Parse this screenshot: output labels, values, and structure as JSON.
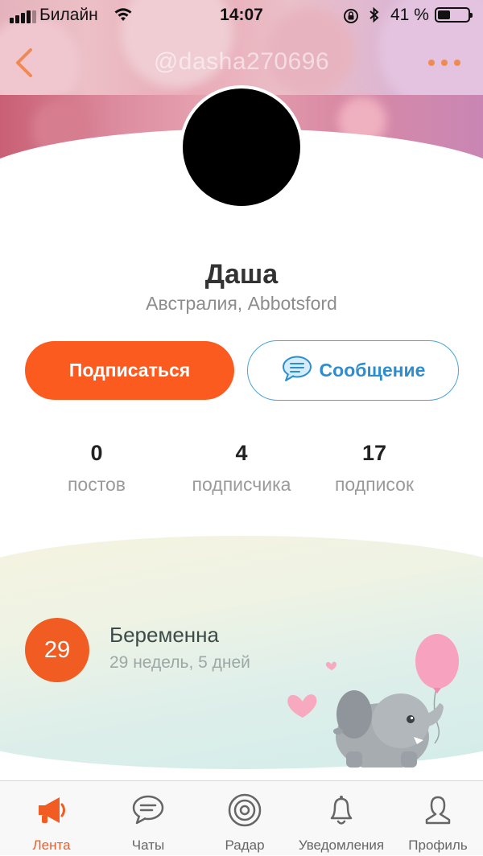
{
  "status_bar": {
    "carrier": "Билайн",
    "time": "14:07",
    "battery_text": "41 %",
    "battery_level": 0.41
  },
  "nav": {
    "title": "@dasha270696"
  },
  "profile": {
    "name": "Даша",
    "location": "Австралия, Abbotsford"
  },
  "actions": {
    "subscribe_label": "Подписаться",
    "message_label": "Сообщение"
  },
  "stats": [
    {
      "value": "0",
      "label": "постов"
    },
    {
      "value": "4",
      "label": "подписчика"
    },
    {
      "value": "17",
      "label": "подписок"
    }
  ],
  "pregnancy": {
    "week": "29",
    "title": "Беременна",
    "subtitle": "29 недель, 5 дней"
  },
  "tabs": [
    {
      "label": "Лента",
      "icon": "megaphone-icon"
    },
    {
      "label": "Чаты",
      "icon": "chat-bubble-icon"
    },
    {
      "label": "Радар",
      "icon": "radar-icon"
    },
    {
      "label": "Уведомления",
      "icon": "bell-icon"
    },
    {
      "label": "Профиль",
      "icon": "person-icon"
    }
  ],
  "colors": {
    "accent": "#fb5b1f",
    "link_blue": "#2b8ed0",
    "pregnancy_badge": "#f15c22"
  }
}
